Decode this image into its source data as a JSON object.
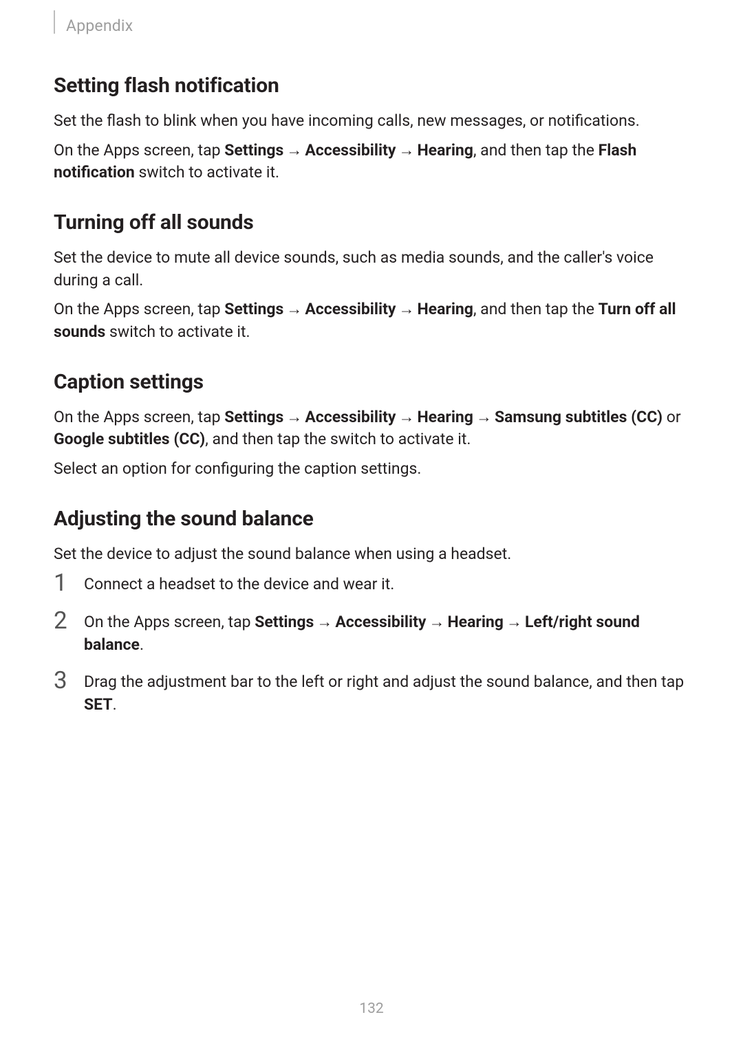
{
  "header": {
    "breadcrumb": "Appendix"
  },
  "sections": {
    "s1": {
      "title": "Setting flash notification",
      "p1": "Set the flash to blink when you have incoming calls, new messages, or notifications.",
      "p2a": "On the Apps screen, tap ",
      "p2_settings": "Settings",
      "p2_arrow1": "→",
      "p2_access": "Accessibility",
      "p2_arrow2": "→",
      "p2_hearing": "Hearing",
      "p2b": ", and then tap the ",
      "p2_flash": "Flash notification",
      "p2c": " switch to activate it."
    },
    "s2": {
      "title": "Turning off all sounds",
      "p1": "Set the device to mute all device sounds, such as media sounds, and the caller's voice during a call.",
      "p2a": "On the Apps screen, tap ",
      "p2_settings": "Settings",
      "p2_arrow1": "→",
      "p2_access": "Accessibility",
      "p2_arrow2": "→",
      "p2_hearing": "Hearing",
      "p2b": ", and then tap the ",
      "p2_turnoff": "Turn off all sounds",
      "p2c": " switch to activate it."
    },
    "s3": {
      "title": "Caption settings",
      "p1a": "On the Apps screen, tap ",
      "p1_settings": "Settings",
      "p1_arrow1": "→",
      "p1_access": "Accessibility",
      "p1_arrow2": "→",
      "p1_hearing": "Hearing",
      "p1_arrow3": "→",
      "p1_samsung": "Samsung subtitles (CC)",
      "p1b": " or ",
      "p1_google": "Google subtitles (CC)",
      "p1c": ", and then tap the switch to activate it.",
      "p2": "Select an option for configuring the caption settings."
    },
    "s4": {
      "title": "Adjusting the sound balance",
      "p1": "Set the device to adjust the sound balance when using a headset.",
      "steps": {
        "n1": "1",
        "t1": "Connect a headset to the device and wear it.",
        "n2": "2",
        "t2a": "On the Apps screen, tap ",
        "t2_settings": "Settings",
        "t2_arrow1": "→",
        "t2_access": "Accessibility",
        "t2_arrow2": "→",
        "t2_hearing": "Hearing",
        "t2_arrow3": "→",
        "t2_lr": "Left/right sound balance",
        "t2b": ".",
        "n3": "3",
        "t3a": "Drag the adjustment bar to the left or right and adjust the sound balance, and then tap ",
        "t3_set": "SET",
        "t3b": "."
      }
    }
  },
  "page_number": "132"
}
